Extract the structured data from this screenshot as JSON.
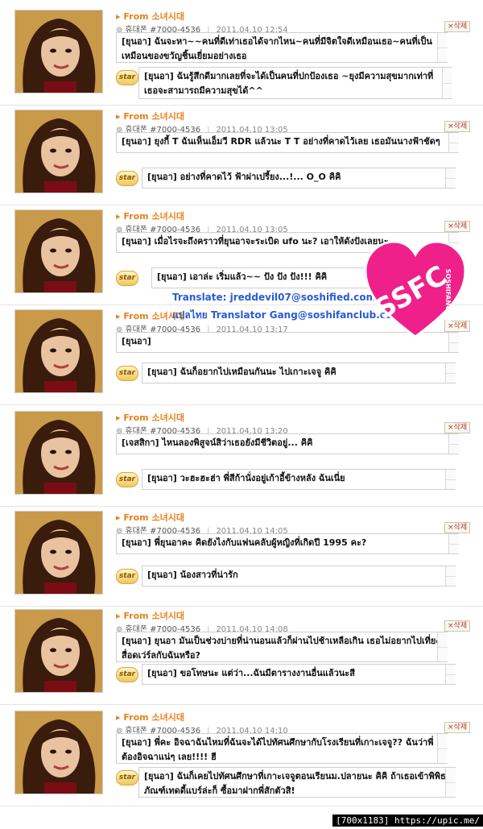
{
  "labels": {
    "from": "From",
    "group": "소녀시대",
    "phone": "휴대폰 #7000-4536",
    "delete": "×삭제",
    "star": "star"
  },
  "entries": [
    {
      "date": "2011.04.10 12:54",
      "message": "[ยุนอา] ฉันจะหา~~คนที่ดีเท่าเธอได้จากไหน~คนที่มีจิตใจดีเหมือนเธอ~คนที่เป็นเหมือนของขวัญชิ้นเยี่ยมอย่างเธอ",
      "reply": "[ยุนอา] ฉันรู้สึกดีมากเลยที่จะได้เป็นคนที่ปกป้องเธอ ~ยุงมีความสุขมากเท่าที่เธอจะสามารถมีความสุขได้^^"
    },
    {
      "date": "2011.04.10 13:05",
      "message": "[ยุนอา] ยุงกี้ T ฉันเห็นเอ็มวี RDR แล้วนะ T T อย่างที่คาดไว้เลย เธอมันนางฟ้าชัดๆ",
      "reply": "[ยุนอา] อย่างที่คาดไว้ ฟ้าผ่าเปรี้ยง...!... O_O คิคิ"
    },
    {
      "date": "2011.04.10 13:05",
      "message": "[ยุนอา] เมื่อไรจะถึงคราวที่ยุนอาจะระเบิด ufo นะ? เอาให้ดังปังเลยนะ",
      "reply": "[ยุนอา] เอาล่ะ เริ่มแล้ว~~ ปัง ปัง ปัง!!! คิคิ"
    },
    {
      "date": "2011.04.10 13:17",
      "message": "[ยุนอา]",
      "reply": "[ยุนอา] ฉันก็อยากไปเหมือนกันนะ ไปเกาะเจจู คิคิ"
    },
    {
      "date": "2011.04.10 13:20",
      "message": "[เจสสิกา] ไหนลองพิสูจน์สิว่าเธอยังมีชีวิตอยู่... คิคิ",
      "reply": "[ยุนอา] วะฮะฮะฮ่า พี่สีก้านั่งอยู่เก้าอี้ข้างหลัง ฉันเนี่ย"
    },
    {
      "date": "2011.04.10 14:05",
      "message": "[ยุนอา] พี่ยุนอาคะ คิดยังไงกับแฟนคลับผู้หญิงที่เกิดปี 1995 คะ?",
      "reply": "[ยุนอา] น้องสาวที่น่ารัก"
    },
    {
      "date": "2011.04.10 14:08",
      "message": "[ยุนอา] ยุนอา มันเป็นช่วงบ่ายที่น่านอนแล้วก็ผ่านไปช้าเหลือเกิน เธอไม่อยากไปเที่ยงสื่อดเว่ร์ลกับฉันหรือ?",
      "reply": "[ยุนอา] ขอโทษนะ แต่ว่า...ฉันมีตารางงานอื่นแล้วนะสี"
    },
    {
      "date": "2011.04.10 14:10",
      "message": "[ยุนอา] พี่คะ อิจฉาฉันไหมที่ฉันจะได้ไปทัศนศึกษากับโรงเรียนที่เกาะเจจู?? ฉันว่าพี่ต้องอิจฉาแน่ๆ เลย!!!! ฮี",
      "reply": "[ยุนอา] ฉันก็เคยไปทัศนศึกษาที่เกาะเจจูตอนเรียนม.ปลายนะ คิคิ ถ้าเธอเข้าพิพิธภัณฑ์เทดดี้แบร์ล่ะก็ ซื้อมาฝากพี่สักตัวสิ!"
    }
  ],
  "watermark": {
    "translate": "Translate: jreddevil07@soshified.com",
    "thai": "แปลไทย Translator Gang@soshifanclub.com",
    "logo_text": "SSFC",
    "logo_sub": "SOSHIFANCLUB"
  },
  "footer": "[700x1183] https://upic.me/"
}
